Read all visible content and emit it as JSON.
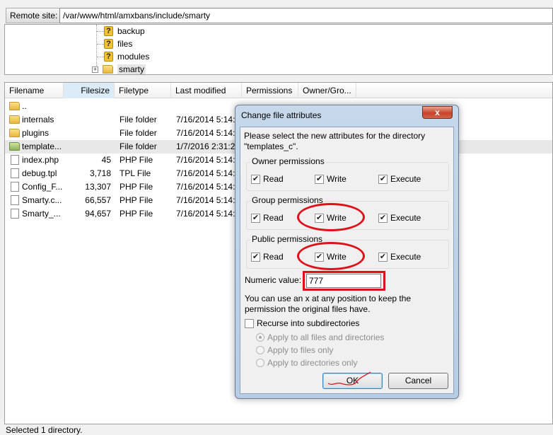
{
  "remote": {
    "label": "Remote site:",
    "path": "/var/www/html/amxbans/include/smarty"
  },
  "tree": {
    "items": [
      {
        "name": "backup",
        "icon": "unknown-folder-icon"
      },
      {
        "name": "files",
        "icon": "unknown-folder-icon"
      },
      {
        "name": "modules",
        "icon": "unknown-folder-icon"
      },
      {
        "name": "smarty",
        "icon": "folder-icon",
        "expander": "+"
      }
    ]
  },
  "filelist": {
    "columns": [
      "Filename",
      "Filesize",
      "Filetype",
      "Last modified",
      "Permissions",
      "Owner/Gro..."
    ],
    "rows": [
      {
        "name": "..",
        "size": "",
        "type": "",
        "modified": "",
        "icon": "folder-icon"
      },
      {
        "name": "internals",
        "size": "",
        "type": "File folder",
        "modified": "7/16/2014 5:14:..",
        "icon": "folder-icon"
      },
      {
        "name": "plugins",
        "size": "",
        "type": "File folder",
        "modified": "7/16/2014 5:14:..",
        "icon": "folder-icon"
      },
      {
        "name": "template...",
        "size": "",
        "type": "File folder",
        "modified": "1/7/2016 2:31:2..",
        "icon": "folder-icon"
      },
      {
        "name": "index.php",
        "size": "45",
        "type": "PHP File",
        "modified": "7/16/2014 5:14:..",
        "icon": "file-icon"
      },
      {
        "name": "debug.tpl",
        "size": "3,718",
        "type": "TPL File",
        "modified": "7/16/2014 5:14:..",
        "icon": "file-icon"
      },
      {
        "name": "Config_F...",
        "size": "13,307",
        "type": "PHP File",
        "modified": "7/16/2014 5:14:..",
        "icon": "file-icon"
      },
      {
        "name": "Smarty.c...",
        "size": "66,557",
        "type": "PHP File",
        "modified": "7/16/2014 5:14:..",
        "icon": "file-icon"
      },
      {
        "name": "Smarty_...",
        "size": "94,657",
        "type": "PHP File",
        "modified": "7/16/2014 5:14:..",
        "icon": "file-icon"
      }
    ]
  },
  "status": "Selected 1 directory.",
  "dialog": {
    "title": "Change file attributes",
    "close": "x",
    "description": "Please select the new attributes for the directory \"templates_c\".",
    "owner": {
      "label": "Owner permissions",
      "read": "Read",
      "write": "Write",
      "execute": "Execute"
    },
    "group": {
      "label": "Group permissions",
      "read": "Read",
      "write": "Write",
      "execute": "Execute"
    },
    "public": {
      "label": "Public permissions",
      "read": "Read",
      "write": "Write",
      "execute": "Execute"
    },
    "numeric_label": "Numeric value:",
    "numeric_value": "777",
    "hint": "You can use an x at any position to keep the permission the original files have.",
    "recurse": "Recurse into subdirectories",
    "apply_all": "Apply to all files and directories",
    "apply_files": "Apply to files only",
    "apply_dirs": "Apply to directories only",
    "ok": "OK",
    "cancel": "Cancel",
    "check_mark": "✔"
  },
  "colors": {
    "annotation": "#e0101a",
    "dialog_frame": "#b7cde4",
    "close_button": "#c8432a"
  }
}
